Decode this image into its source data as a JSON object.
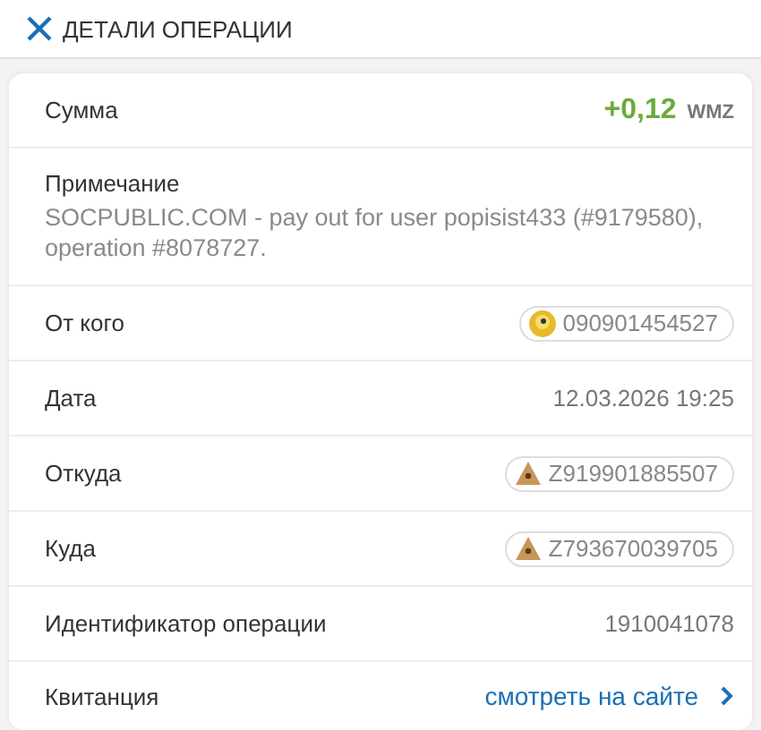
{
  "header": {
    "title": "ДЕТАЛИ ОПЕРАЦИИ"
  },
  "rows": [
    {
      "kind": "amount",
      "label": "Сумма",
      "value": "+0,12",
      "unit": "WMZ"
    },
    {
      "kind": "note",
      "label": "Примечание",
      "value": "SOCPUBLIC.COM - pay out for user popisist433 (#9179580), operation #8078727."
    },
    {
      "kind": "wmid",
      "label": "От кого",
      "value": "090901454527"
    },
    {
      "kind": "text",
      "label": "Дата",
      "value": "12.03.2026 19:25"
    },
    {
      "kind": "purse",
      "label": "Откуда",
      "value": "Z919901885507"
    },
    {
      "kind": "purse",
      "label": "Куда",
      "value": "Z793670039705"
    },
    {
      "kind": "text",
      "label": "Идентификатор операции",
      "value": "1910041078"
    },
    {
      "kind": "link",
      "label": "Квитанция",
      "value": "смотреть на сайте"
    }
  ]
}
